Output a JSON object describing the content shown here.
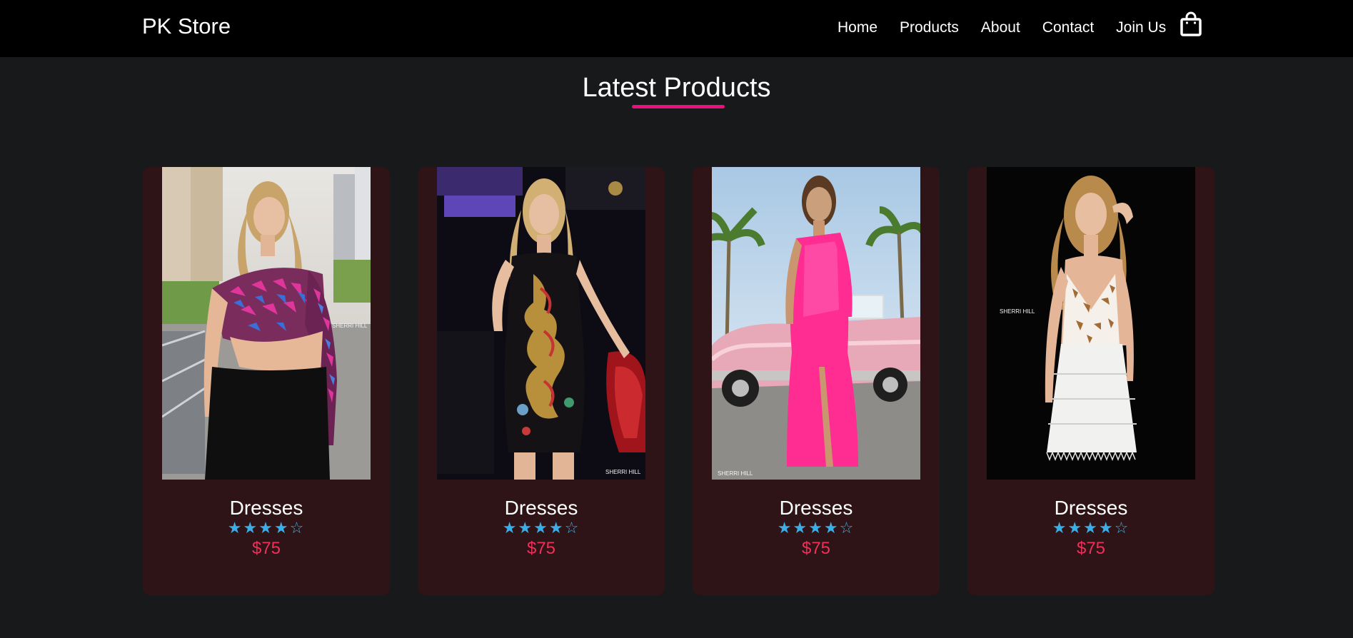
{
  "header": {
    "brand": "PK Store",
    "nav": [
      "Home",
      "Products",
      "About",
      "Contact",
      "Join Us"
    ],
    "cart_icon": "shopping-bag-icon"
  },
  "section": {
    "title": "Latest Products",
    "accent_color": "#e8107a"
  },
  "products": [
    {
      "title": "Dresses",
      "rating": 4,
      "rating_max": 5,
      "stars": "★★★★☆",
      "price": "$75",
      "watermark": "SHERRI HILL"
    },
    {
      "title": "Dresses",
      "rating": 4,
      "rating_max": 5,
      "stars": "★★★★☆",
      "price": "$75",
      "watermark": "SHERRI HILL"
    },
    {
      "title": "Dresses",
      "rating": 4,
      "rating_max": 5,
      "stars": "★★★★☆",
      "price": "$75",
      "watermark": "SHERRI HILL"
    },
    {
      "title": "Dresses",
      "rating": 4,
      "rating_max": 5,
      "stars": "★★★★☆",
      "price": "$75",
      "watermark": "SHERRI HILL"
    }
  ],
  "colors": {
    "page_bg": "#18191b",
    "nav_bg": "#000000",
    "card_bg": "#2e1416",
    "star": "#3aaee8",
    "price": "#f0305a"
  }
}
